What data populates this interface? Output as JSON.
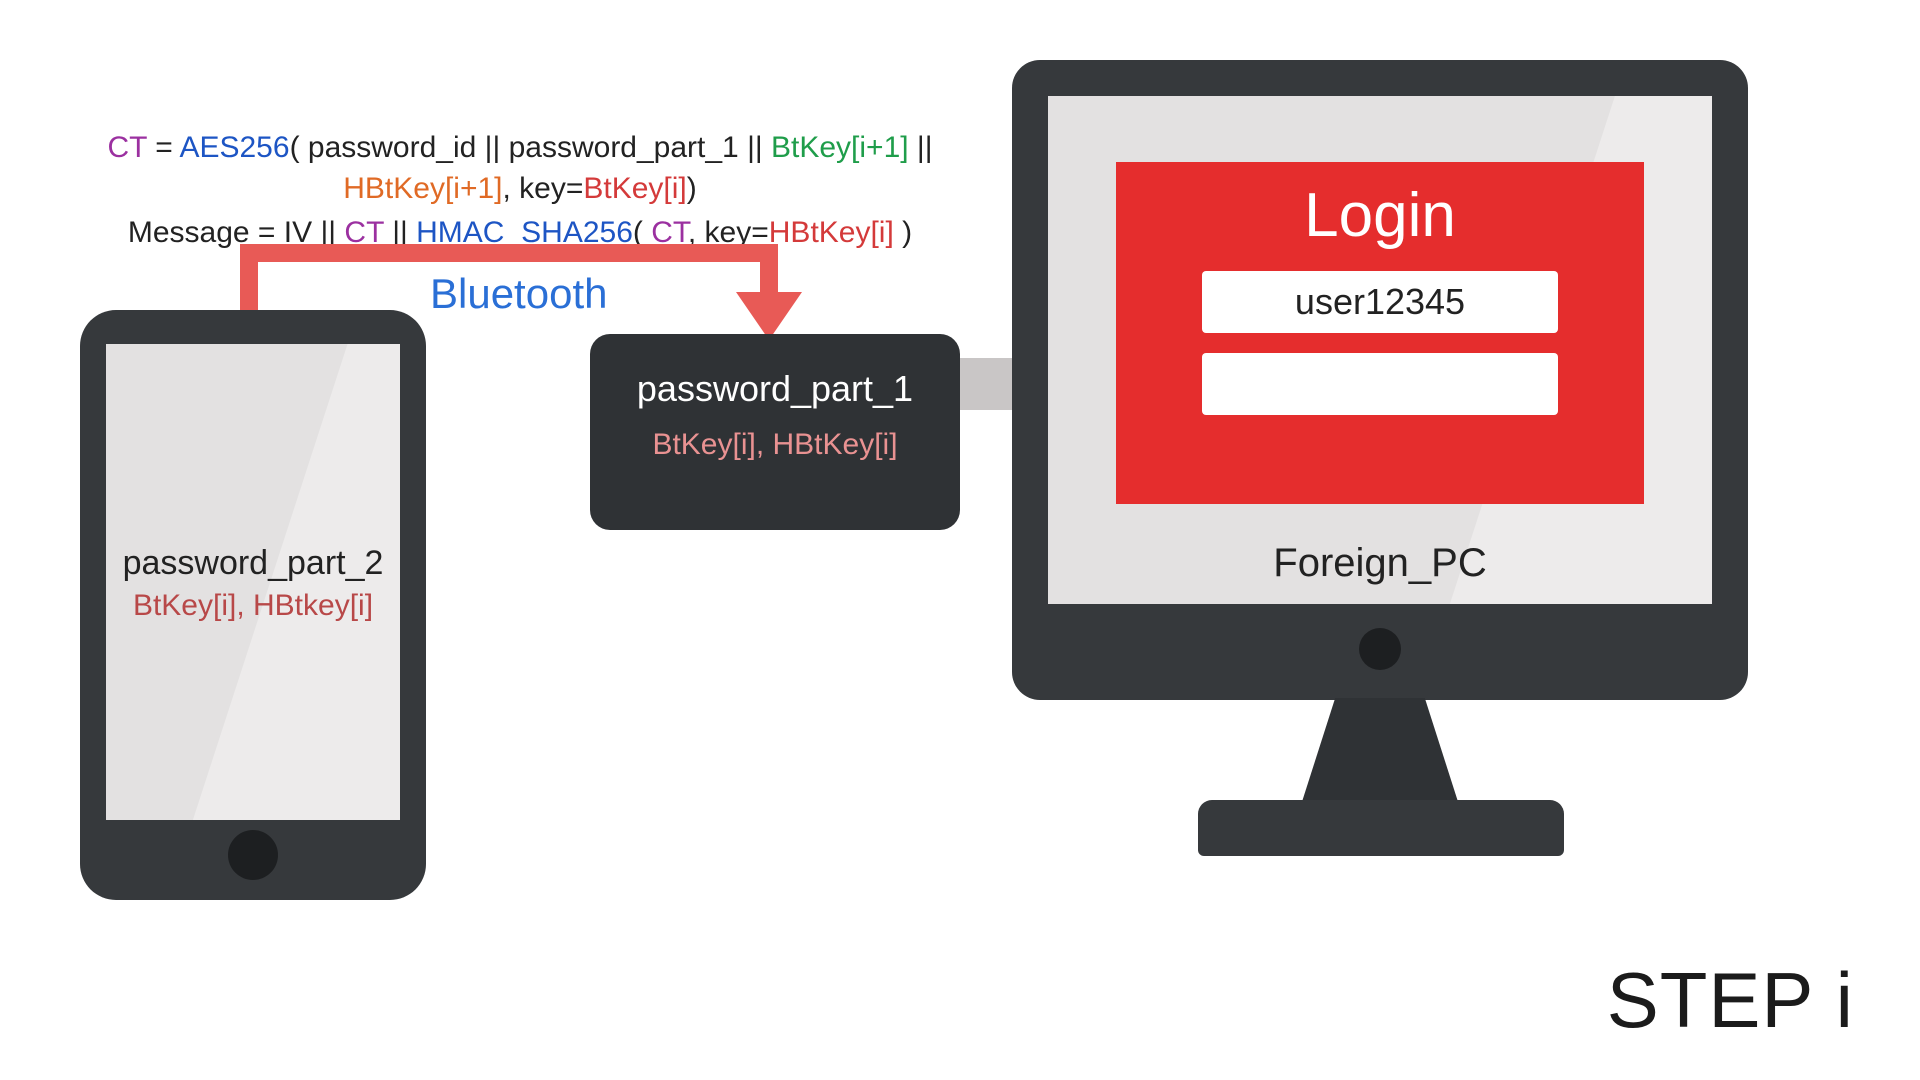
{
  "formula": {
    "line1": {
      "ct": "CT",
      "eq": " = ",
      "aes": "AES256",
      "open": "( ",
      "p1": "password_id",
      "sep": " || ",
      "p2": "password_part_1",
      "bt": "BtKey[i+1]",
      "hbt": "HBtKey[i+1]",
      "keylbl": ", key=",
      "keyval": "BtKey[i]",
      "close": ")"
    },
    "line2": {
      "msg": "Message = ",
      "iv": "IV",
      "sep": " || ",
      "ct": "CT",
      "hmac": "HMAC_SHA256",
      "open": "( ",
      "keylbl": ", key=",
      "keyval": "HBtKey[i]",
      "close": " )"
    }
  },
  "bluetooth_label": "Bluetooth",
  "phone": {
    "line1": "password_part_2",
    "line2": "BtKey[i], HBtkey[i]"
  },
  "usb": {
    "line1": "password_part_1",
    "line2": "BtKey[i], HBtKey[i]"
  },
  "monitor": {
    "login_title": "Login",
    "username": "user12345",
    "password": "",
    "label": "Foreign_PC"
  },
  "step_label": "STEP i"
}
